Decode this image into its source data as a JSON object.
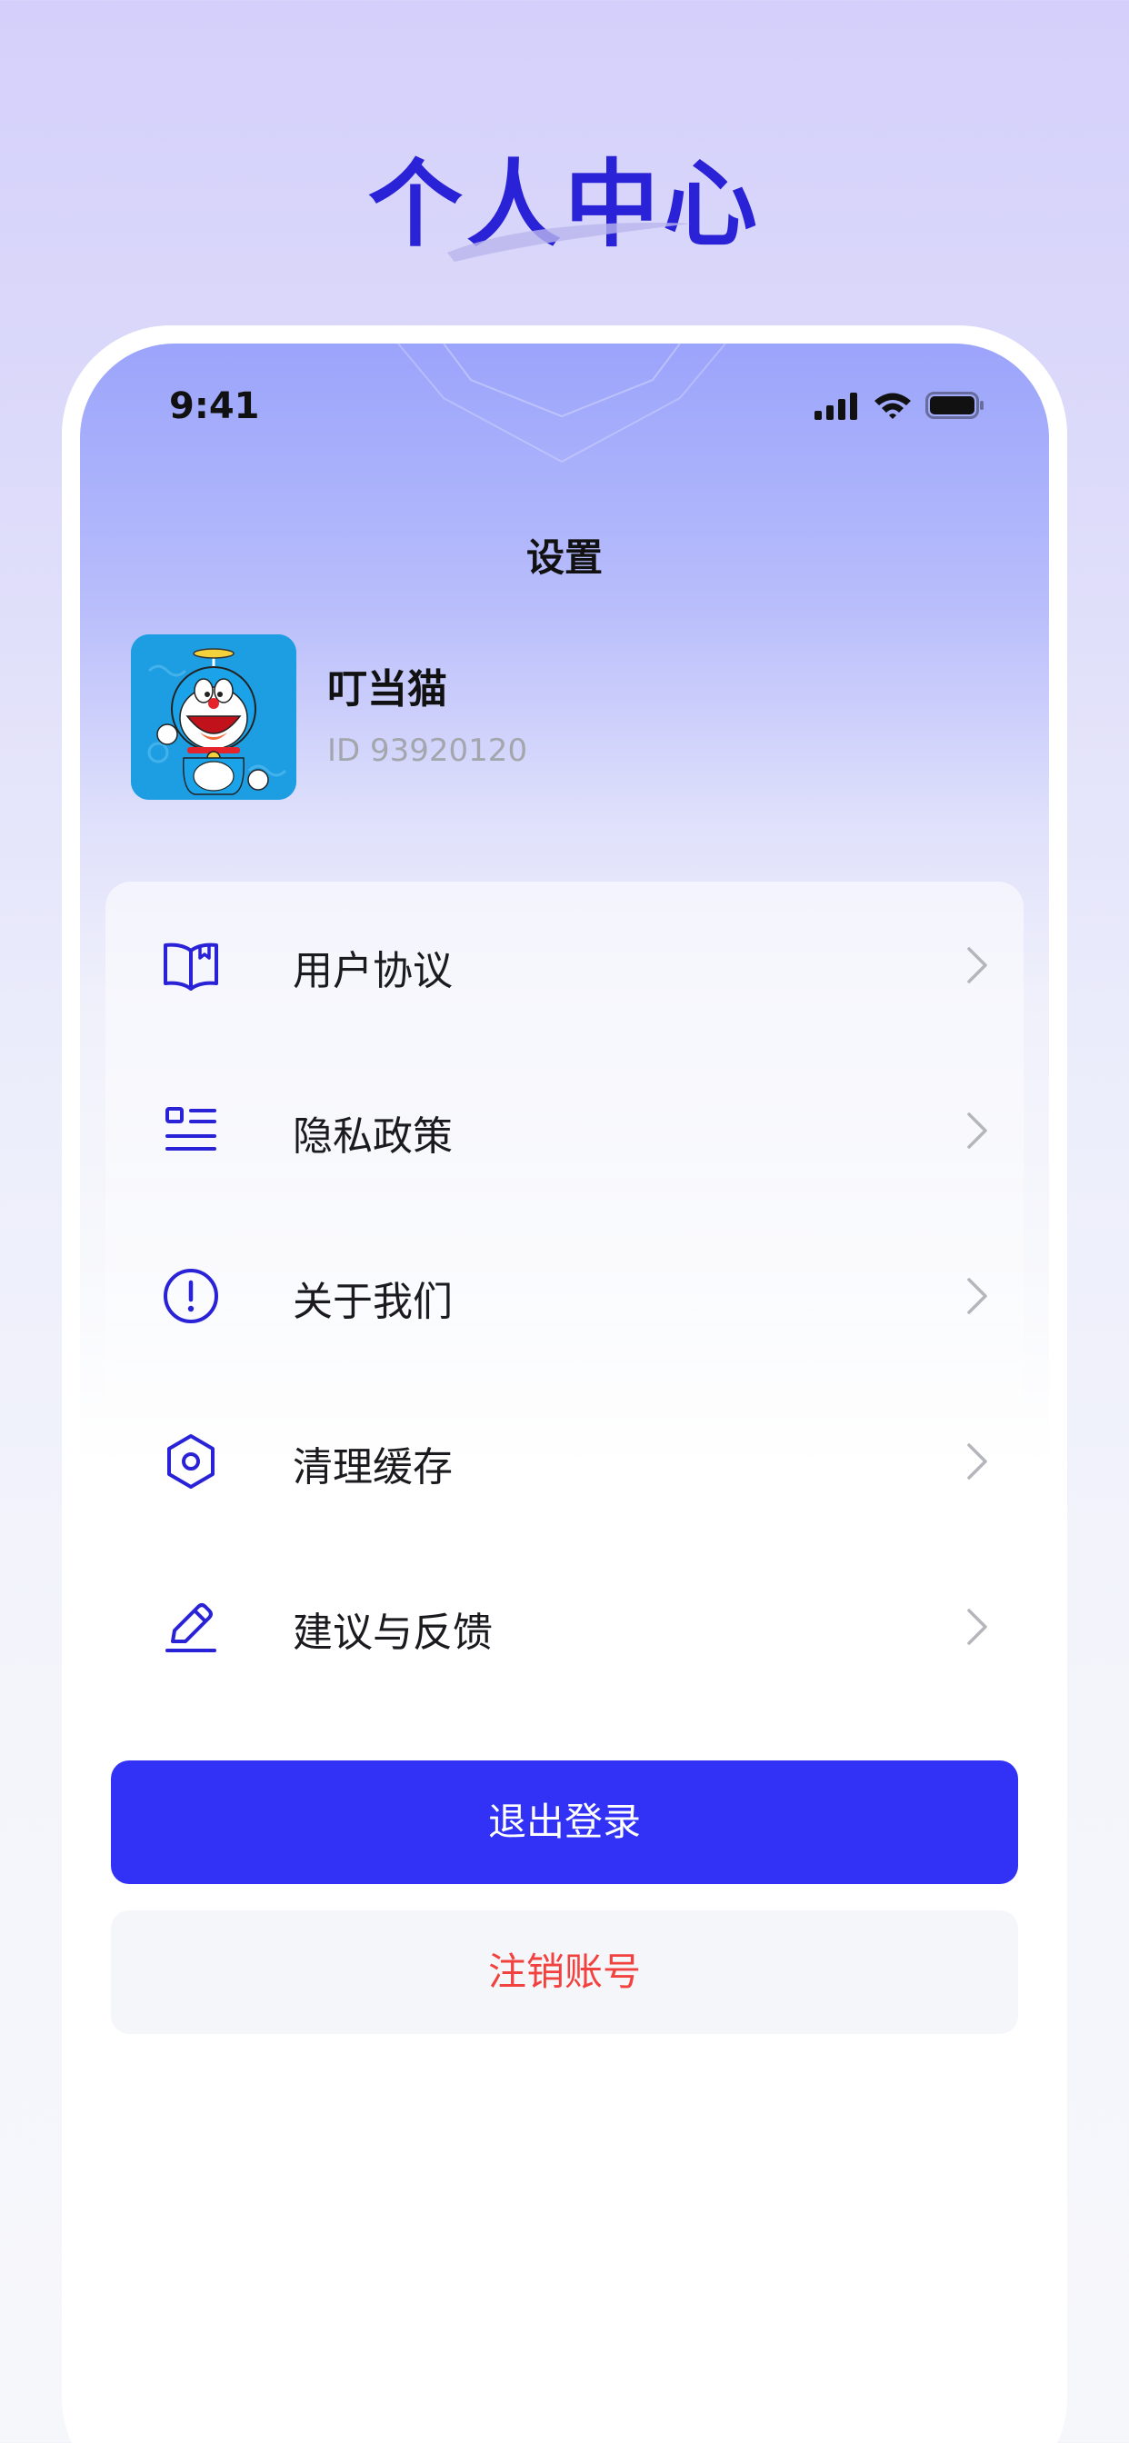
{
  "hero": {
    "title": "个人中心"
  },
  "status_bar": {
    "time": "9:41"
  },
  "nav": {
    "title": "设置"
  },
  "profile": {
    "name": "叮当猫",
    "id_text": "ID 93920120"
  },
  "menu": {
    "items": [
      {
        "label": "用户协议",
        "icon": "book-icon"
      },
      {
        "label": "隐私政策",
        "icon": "list-icon"
      },
      {
        "label": "关于我们",
        "icon": "info-circle-icon"
      },
      {
        "label": "清理缓存",
        "icon": "hexagon-icon"
      },
      {
        "label": "建议与反馈",
        "icon": "pencil-icon"
      }
    ]
  },
  "actions": {
    "logout_label": "退出登录",
    "delete_account_label": "注销账号"
  },
  "colors": {
    "accent": "#3232f6",
    "icon": "#2a22d6",
    "danger": "#f1423f",
    "muted_text": "#a4a6ad"
  }
}
